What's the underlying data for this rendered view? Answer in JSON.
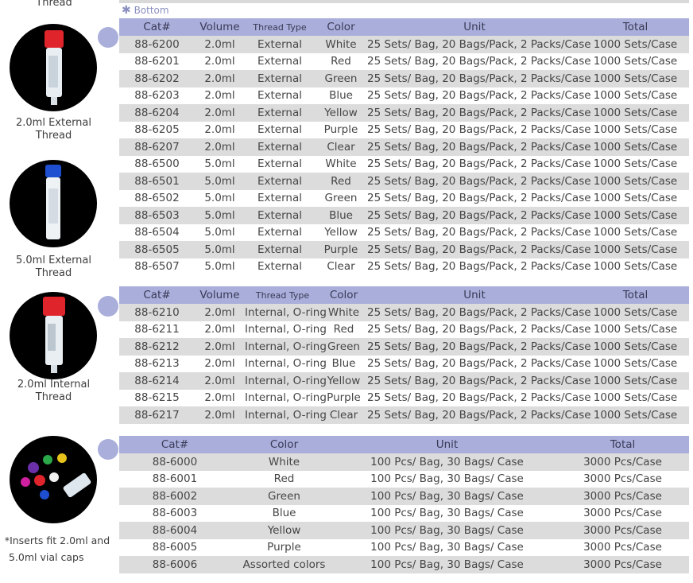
{
  "header": {
    "top_label": "Thread",
    "bottom_note_icon": "asterisk-icon",
    "bottom_note": "Bottom"
  },
  "colors": {
    "header_bg": "#a9aedb",
    "row_alt": "#dcdcdc",
    "bullet": "#a9aedb"
  },
  "sections": [
    {
      "label_line1": "2.0ml External",
      "label_line2": "Thread",
      "headers": [
        "Cat#",
        "Volume",
        "Thread Type",
        "Color",
        "Unit",
        "Total"
      ],
      "rows": [
        [
          "88-6200",
          "2.0ml",
          "External",
          "White",
          "25 Sets/ Bag, 20 Bags/Pack, 2 Packs/Case",
          "1000 Sets/Case"
        ],
        [
          "88-6201",
          "2.0ml",
          "External",
          "Red",
          "25 Sets/ Bag, 20 Bags/Pack, 2 Packs/Case",
          "1000 Sets/Case"
        ],
        [
          "88-6202",
          "2.0ml",
          "External",
          "Green",
          "25 Sets/ Bag, 20 Bags/Pack, 2 Packs/Case",
          "1000 Sets/Case"
        ],
        [
          "88-6203",
          "2.0ml",
          "External",
          "Blue",
          "25 Sets/ Bag, 20 Bags/Pack, 2 Packs/Case",
          "1000 Sets/Case"
        ],
        [
          "88-6204",
          "2.0ml",
          "External",
          "Yellow",
          "25 Sets/ Bag, 20 Bags/Pack, 2 Packs/Case",
          "1000 Sets/Case"
        ],
        [
          "88-6205",
          "2.0ml",
          "External",
          "Purple",
          "25 Sets/ Bag, 20 Bags/Pack, 2 Packs/Case",
          "1000 Sets/Case"
        ],
        [
          "88-6207",
          "2.0ml",
          "External",
          "Clear",
          "25 Sets/ Bag, 20 Bags/Pack, 2 Packs/Case",
          "1000 Sets/Case"
        ],
        [
          "88-6500",
          "5.0ml",
          "External",
          "White",
          "25 Sets/ Bag, 20 Bags/Pack, 2 Packs/Case",
          "1000 Sets/Case"
        ],
        [
          "88-6501",
          "5.0ml",
          "External",
          "Red",
          "25 Sets/ Bag, 20 Bags/Pack, 2 Packs/Case",
          "1000 Sets/Case"
        ],
        [
          "88-6502",
          "5.0ml",
          "External",
          "Green",
          "25 Sets/ Bag, 20 Bags/Pack, 2 Packs/Case",
          "1000 Sets/Case"
        ],
        [
          "88-6503",
          "5.0ml",
          "External",
          "Blue",
          "25 Sets/ Bag, 20 Bags/Pack, 2 Packs/Case",
          "1000 Sets/Case"
        ],
        [
          "88-6504",
          "5.0ml",
          "External",
          "Yellow",
          "25 Sets/ Bag, 20 Bags/Pack, 2 Packs/Case",
          "1000 Sets/Case"
        ],
        [
          "88-6505",
          "5.0ml",
          "External",
          "Purple",
          "25 Sets/ Bag, 20 Bags/Pack, 2 Packs/Case",
          "1000 Sets/Case"
        ],
        [
          "88-6507",
          "5.0ml",
          "External",
          "Clear",
          "25 Sets/ Bag, 20 Bags/Pack, 2 Packs/Case",
          "1000 Sets/Case"
        ]
      ]
    },
    {
      "label_line1": "5.0ml External",
      "label_line2": "Thread"
    },
    {
      "label_line1": "2.0ml Internal",
      "label_line2": "Thread",
      "headers": [
        "Cat#",
        "Volume",
        "Thread Type",
        "Color",
        "Unit",
        "Total"
      ],
      "rows": [
        [
          "88-6210",
          "2.0ml",
          "Internal, O-ring",
          "White",
          "25 Sets/ Bag, 20 Bags/Pack, 2 Packs/Case",
          "1000 Sets/Case"
        ],
        [
          "88-6211",
          "2.0ml",
          "Internal, O-ring",
          "Red",
          "25 Sets/ Bag, 20 Bags/Pack, 2 Packs/Case",
          "1000 Sets/Case"
        ],
        [
          "88-6212",
          "2.0ml",
          "Internal, O-ring",
          "Green",
          "25 Sets/ Bag, 20 Bags/Pack, 2 Packs/Case",
          "1000 Sets/Case"
        ],
        [
          "88-6213",
          "2.0ml",
          "Internal, O-ring",
          "Blue",
          "25 Sets/ Bag, 20 Bags/Pack, 2 Packs/Case",
          "1000 Sets/Case"
        ],
        [
          "88-6214",
          "2.0ml",
          "Internal, O-ring",
          "Yellow",
          "25 Sets/ Bag, 20 Bags/Pack, 2 Packs/Case",
          "1000 Sets/Case"
        ],
        [
          "88-6215",
          "2.0ml",
          "Internal, O-ring",
          "Purple",
          "25 Sets/ Bag, 20 Bags/Pack, 2 Packs/Case",
          "1000 Sets/Case"
        ],
        [
          "88-6217",
          "2.0ml",
          "Internal, O-ring",
          "Clear",
          "25 Sets/ Bag, 20 Bags/Pack, 2 Packs/Case",
          "1000 Sets/Case"
        ]
      ]
    },
    {
      "label_line1": "*Inserts fit 2.0ml and",
      "label_line2": "5.0ml vial caps",
      "headers": [
        "Cat#",
        "Color",
        "Unit",
        "Total"
      ],
      "rows": [
        [
          "88-6000",
          "White",
          "100 Pcs/ Bag, 30 Bags/ Case",
          "3000 Pcs/Case"
        ],
        [
          "88-6001",
          "Red",
          "100 Pcs/ Bag, 30 Bags/ Case",
          "3000 Pcs/Case"
        ],
        [
          "88-6002",
          "Green",
          "100 Pcs/ Bag, 30 Bags/ Case",
          "3000 Pcs/Case"
        ],
        [
          "88-6003",
          "Blue",
          "100 Pcs/ Bag, 30 Bags/ Case",
          "3000 Pcs/Case"
        ],
        [
          "88-6004",
          "Yellow",
          "100 Pcs/ Bag, 30 Bags/ Case",
          "3000 Pcs/Case"
        ],
        [
          "88-6005",
          "Purple",
          "100 Pcs/ Bag, 30 Bags/ Case",
          "3000 Pcs/Case"
        ],
        [
          "88-6006",
          "Assorted colors",
          "100 Pcs/ Bag, 30 Bags/ Case",
          "3000 Pcs/Case"
        ]
      ]
    }
  ]
}
